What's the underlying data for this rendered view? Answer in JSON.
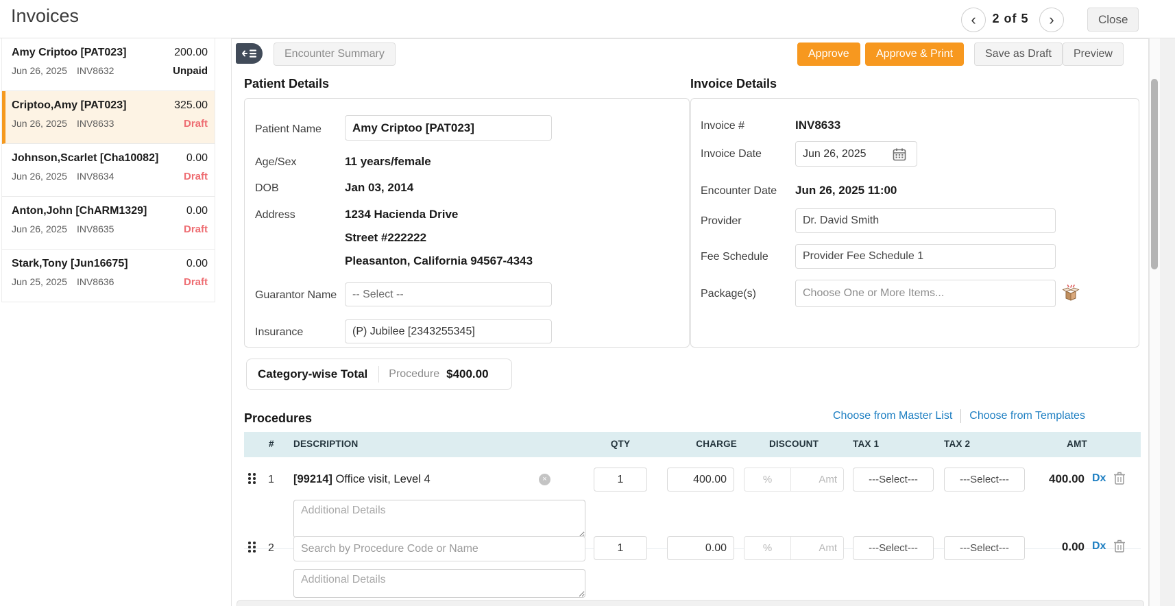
{
  "colors": {
    "accent_orange": "#F7981F",
    "selected_bg": "#FDF3E4",
    "draft_red": "#EE6D72",
    "link_blue": "#1E7FC2",
    "table_header_bg": "#DDEDF0",
    "collapse_icon_bg": "#414B59"
  },
  "header": {
    "title": "Invoices",
    "page_indicator": "2 of 5",
    "close": "Close",
    "prev_glyph": "‹",
    "next_glyph": "›"
  },
  "sidebar": {
    "items": [
      {
        "name": "Amy Criptoo [PAT023]",
        "amount": "200.00",
        "date": "Jun 26, 2025",
        "invoice_no": "INV8632",
        "status": "Unpaid"
      },
      {
        "name": "Criptoo,Amy [PAT023]",
        "amount": "325.00",
        "date": "Jun 26, 2025",
        "invoice_no": "INV8633",
        "status": "Draft"
      },
      {
        "name": "Johnson,Scarlet [Cha10082]",
        "amount": "0.00",
        "date": "Jun 26, 2025",
        "invoice_no": "INV8634",
        "status": "Draft"
      },
      {
        "name": "Anton,John [ChARM1329]",
        "amount": "0.00",
        "date": "Jun 26, 2025",
        "invoice_no": "INV8635",
        "status": "Draft"
      },
      {
        "name": "Stark,Tony [Jun16675]",
        "amount": "0.00",
        "date": "Jun 25, 2025",
        "invoice_no": "INV8636",
        "status": "Draft"
      }
    ]
  },
  "toolbar": {
    "encounter_summary": "Encounter Summary",
    "approve": "Approve",
    "approve_print": "Approve & Print",
    "save_draft": "Save as Draft",
    "preview": "Preview"
  },
  "patient": {
    "heading": "Patient Details",
    "patient_name_label": "Patient Name",
    "patient_name_value": "Amy Criptoo [PAT023]",
    "age_sex_label": "Age/Sex",
    "age_sex_value": "11 years/female",
    "dob_label": "DOB",
    "dob_value": "Jan 03, 2014",
    "address_label": "Address",
    "address_line1": "1234 Hacienda Drive",
    "address_line2": "Street #222222",
    "address_line3": "Pleasanton, California 94567-4343",
    "guarantor_label": "Guarantor Name",
    "guarantor_value": "-- Select --",
    "insurance_label": "Insurance",
    "insurance_value": "(P) Jubilee [2343255345]"
  },
  "invoice": {
    "heading": "Invoice Details",
    "invoice_no_label": "Invoice #",
    "invoice_no": "INV8633",
    "invoice_date_label": "Invoice Date",
    "invoice_date": "Jun 26, 2025",
    "encounter_date_label": "Encounter Date",
    "encounter_date": "Jun 26, 2025 11:00",
    "provider_label": "Provider",
    "provider": "Dr. David Smith",
    "fee_schedule_label": "Fee Schedule",
    "fee_schedule": "Provider Fee Schedule 1",
    "packages_label": "Package(s)",
    "packages_placeholder": "Choose One or More Items..."
  },
  "category_total": {
    "label": "Category-wise Total",
    "category": "Procedure",
    "amount": "$400.00"
  },
  "procedures": {
    "heading": "Procedures",
    "master_list_link": "Choose from Master List",
    "templates_link": "Choose from Templates",
    "columns": [
      "#",
      "DESCRIPTION",
      "QTY",
      "CHARGE",
      "DISCOUNT",
      "TAX 1",
      "TAX 2",
      "AMT"
    ],
    "rows": [
      {
        "num": "1",
        "code": "[99214]",
        "name": " Office visit, Level 4",
        "qty": "1",
        "charge": "400.00",
        "discount_pct_placeholder": "%",
        "discount_amt_placeholder": "Amt",
        "tax1": "---Select---",
        "tax2": "---Select---",
        "amt": "400.00",
        "dx": "Dx",
        "details_placeholder": "Additional Details"
      },
      {
        "num": "2",
        "search_placeholder": "Search by Procedure Code or Name",
        "qty": "1",
        "charge": "0.00",
        "discount_pct_placeholder": "%",
        "discount_amt_placeholder": "Amt",
        "tax1": "---Select---",
        "tax2": "---Select---",
        "amt": "0.00",
        "dx": "Dx",
        "details_placeholder": "Additional Details"
      }
    ]
  }
}
